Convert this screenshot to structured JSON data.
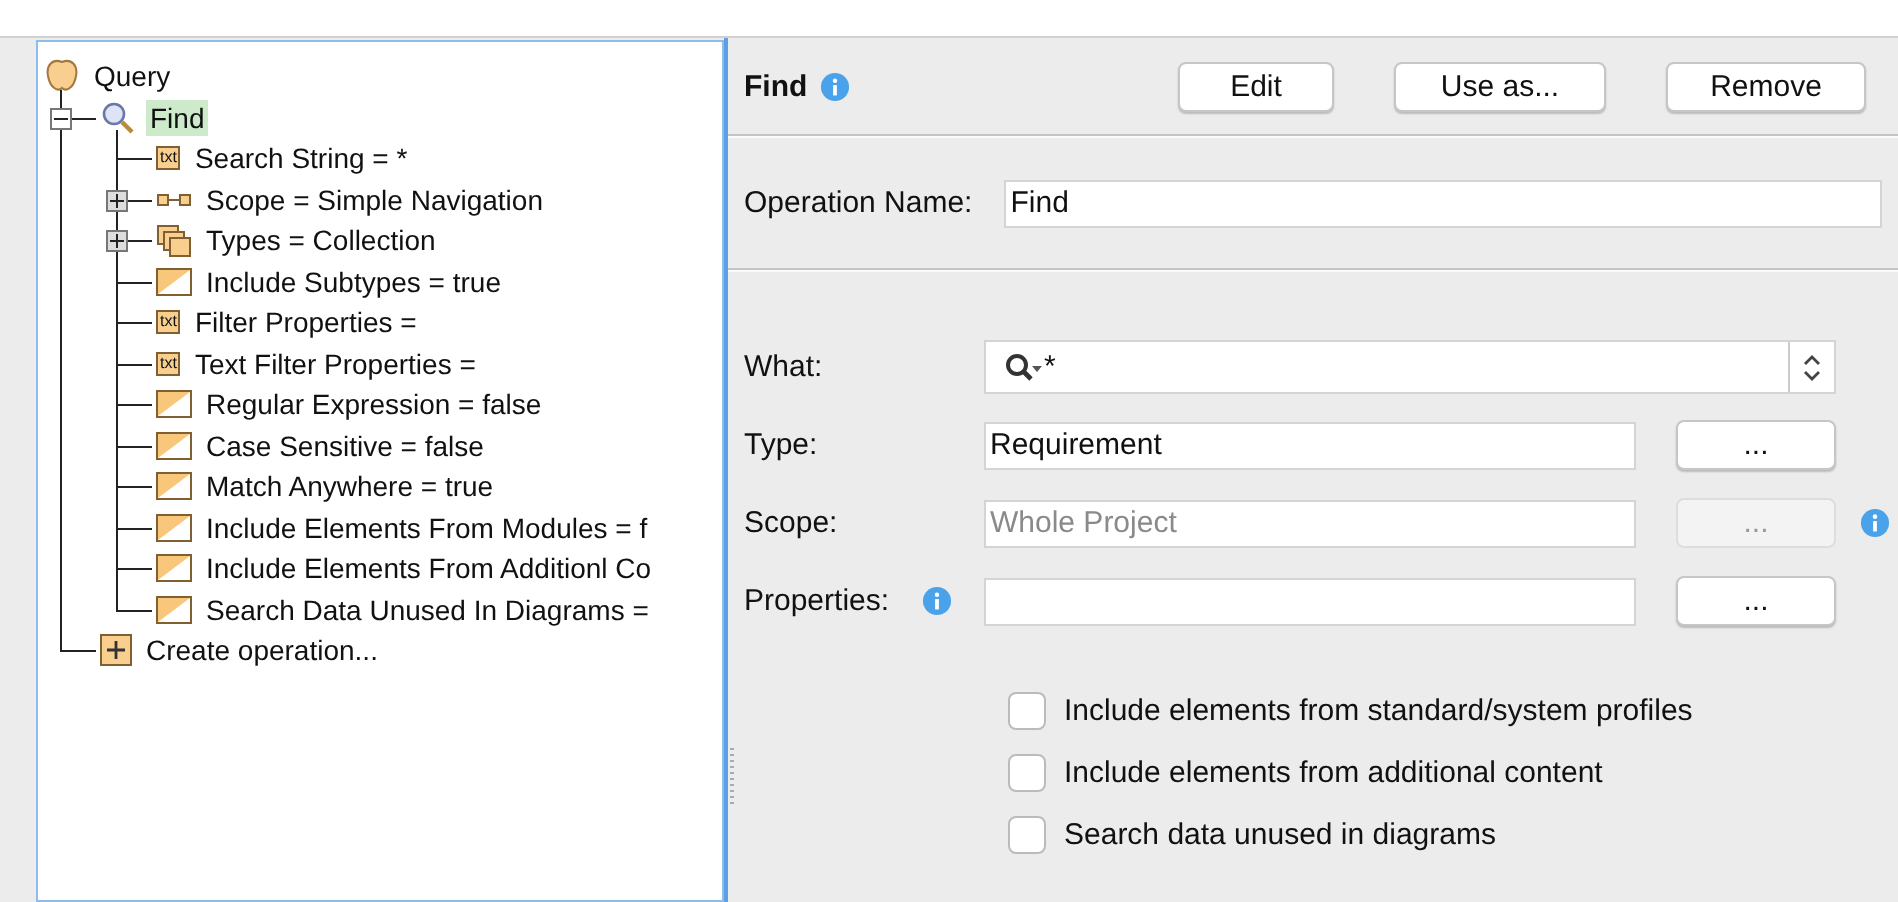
{
  "tree": {
    "label": "Query",
    "kind": "query",
    "selected": false,
    "children": [
      {
        "label": "Find",
        "kind": "search",
        "selected": true,
        "expanded": true,
        "children": [
          {
            "label": "Search String = *",
            "kind": "txt",
            "badge": "txt",
            "selected": false
          },
          {
            "label": "Scope = Simple Navigation",
            "kind": "scope",
            "selected": false,
            "expanded": false
          },
          {
            "label": "Types = Collection",
            "kind": "types",
            "selected": false,
            "expanded": false
          },
          {
            "label": "Include Subtypes = true",
            "kind": "bool",
            "selected": false
          },
          {
            "label": "Filter Properties =",
            "kind": "txt",
            "badge": "txt",
            "selected": false
          },
          {
            "label": "Text Filter Properties =",
            "kind": "txt",
            "badge": "txt",
            "selected": false
          },
          {
            "label": "Regular Expression = false",
            "kind": "bool",
            "selected": false
          },
          {
            "label": "Case Sensitive = false",
            "kind": "bool",
            "selected": false
          },
          {
            "label": "Match Anywhere = true",
            "kind": "bool",
            "selected": false
          },
          {
            "label": "Include Elements From Modules = f",
            "kind": "bool",
            "selected": false
          },
          {
            "label": "Include Elements From Additionl Co",
            "kind": "bool",
            "selected": false
          },
          {
            "label": "Search Data Unused In Diagrams =",
            "kind": "bool",
            "selected": false
          }
        ]
      },
      {
        "label": "Create operation...",
        "kind": "add",
        "selected": false
      }
    ]
  },
  "header": {
    "title": "Find",
    "buttons": [
      "Edit",
      "Use as...",
      "Remove"
    ]
  },
  "operation_name": {
    "label": "Operation Name:",
    "value": "Find"
  },
  "fields": [
    {
      "kind": "combo",
      "label": "What:",
      "value": "*",
      "disabled": false
    },
    {
      "kind": "picker",
      "label": "Type:",
      "value": "Requirement",
      "button": "...",
      "disabled": false
    },
    {
      "kind": "picker",
      "label": "Scope:",
      "placeholder": "Whole Project",
      "button": "...",
      "disabled": true,
      "info_after": true
    },
    {
      "kind": "picker",
      "label": "Properties:",
      "button": "...",
      "disabled": false,
      "info_label": true
    }
  ],
  "options": [
    {
      "label": "Include elements from standard/system profiles",
      "checked": false
    },
    {
      "label": "Include elements from additional content",
      "checked": false
    },
    {
      "label": "Search data unused in diagrams",
      "checked": false
    }
  ]
}
